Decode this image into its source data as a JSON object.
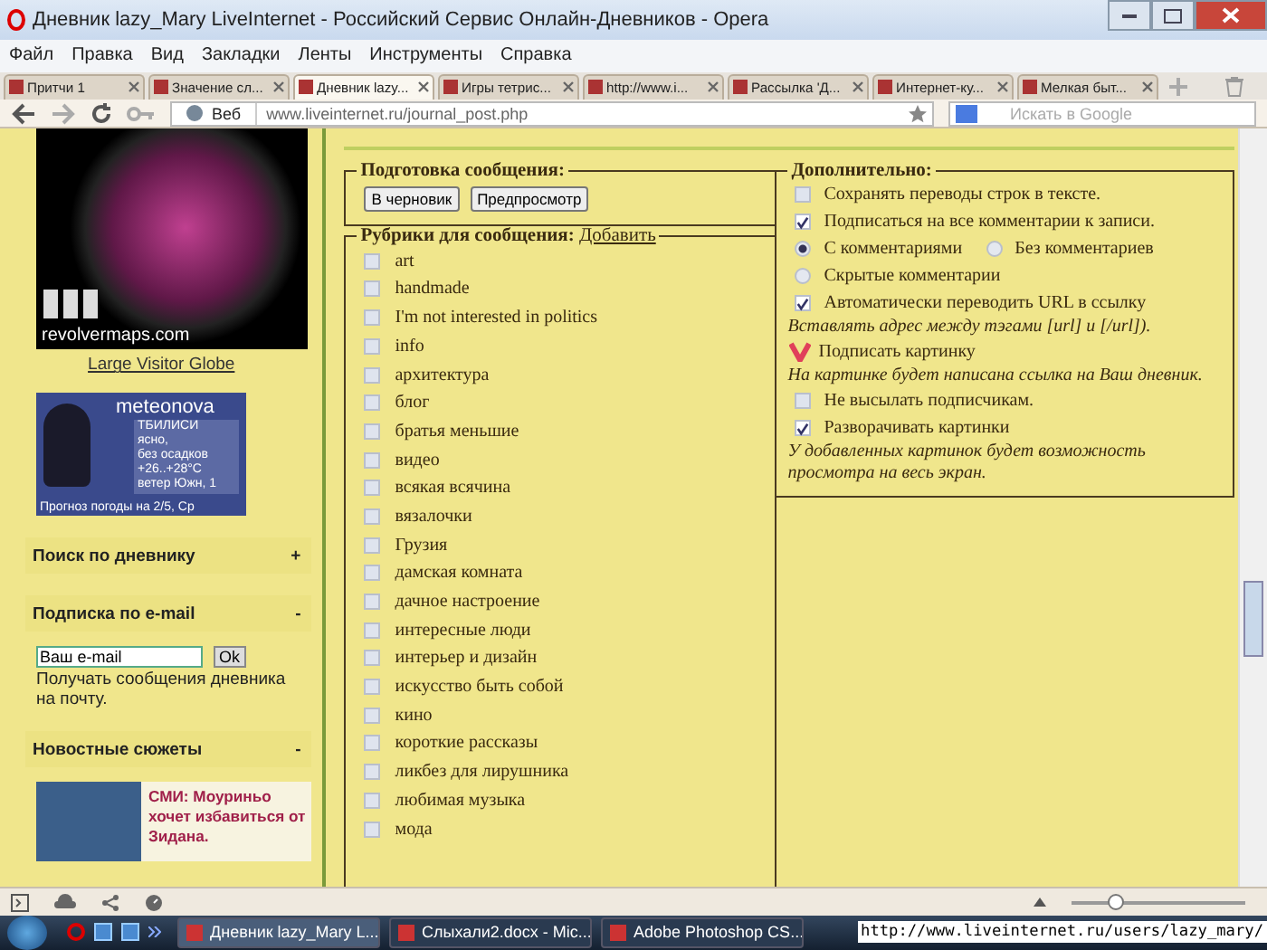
{
  "window": {
    "title": "Дневник lazy_Mary LiveInternet - Российский Сервис Онлайн-Дневников - Opera"
  },
  "menu": [
    "Файл",
    "Правка",
    "Вид",
    "Закладки",
    "Ленты",
    "Инструменты",
    "Справка"
  ],
  "tabs": [
    {
      "label": "Притчи 1",
      "selected": false
    },
    {
      "label": "Значение сл...",
      "selected": false
    },
    {
      "label": "Дневник lazy...",
      "selected": true
    },
    {
      "label": "Игры тетрис...",
      "selected": false
    },
    {
      "label": "http://www.i...",
      "selected": false
    },
    {
      "label": "Рассылка 'Д...",
      "selected": false
    },
    {
      "label": "Интернет-ку...",
      "selected": false
    },
    {
      "label": "Мелкая быт...",
      "selected": false
    }
  ],
  "address": {
    "scope": "Веб",
    "url": "www.liveinternet.ru/journal_post.php",
    "search_placeholder": "Искать в Google"
  },
  "sidebar": {
    "globe": {
      "caption": "revolvermaps.com",
      "link": "Large Visitor Globe"
    },
    "weather": {
      "brand": "meteonova",
      "lines": [
        "ТБИЛИСИ",
        "ясно,",
        "без осадков",
        "+26..+28°C",
        "ветер Южн, 1"
      ],
      "footer": "Прогноз погоды на 2/5, Ср"
    },
    "blocks": [
      {
        "title": "Поиск по дневнику",
        "toggle": "+"
      },
      {
        "title": "Подписка по e-mail",
        "toggle": "-"
      }
    ],
    "subscribe": {
      "value": "Ваш e-mail",
      "button": "Ok",
      "note": "Получать сообщения дневника на почту."
    },
    "news": {
      "title": "Новостные сюжеты",
      "toggle": "-",
      "headline": "СМИ: Моуриньо хочет избавиться от Зидана."
    }
  },
  "prepare": {
    "legend": "Подготовка сообщения:",
    "buttons": [
      "В черновик",
      "Предпросмотр"
    ]
  },
  "rubrics": {
    "legend": "Рубрики для сообщения:",
    "add_link": "Добавить",
    "items": [
      {
        "label": "art",
        "checked": false
      },
      {
        "label": "handmade",
        "checked": false
      },
      {
        "label": "I'm not interested in politics",
        "checked": false
      },
      {
        "label": "info",
        "checked": false
      },
      {
        "label": "архитектура",
        "checked": false
      },
      {
        "label": "блог",
        "checked": false
      },
      {
        "label": "братья меньшие",
        "checked": false
      },
      {
        "label": "видео",
        "checked": false
      },
      {
        "label": "всякая всячина",
        "checked": false
      },
      {
        "label": "вязалочки",
        "checked": false
      },
      {
        "label": "Грузия",
        "checked": false
      },
      {
        "label": "дамская комната",
        "checked": false
      },
      {
        "label": "дачное настроение",
        "checked": false
      },
      {
        "label": "интересные люди",
        "checked": false
      },
      {
        "label": "интерьер и дизайн",
        "checked": false
      },
      {
        "label": "искусство быть собой",
        "checked": false
      },
      {
        "label": "кино",
        "checked": false
      },
      {
        "label": "короткие рассказы",
        "checked": false
      },
      {
        "label": "ликбез для лирушника",
        "checked": false
      },
      {
        "label": "любимая музыка",
        "checked": false
      },
      {
        "label": "мода",
        "checked": false
      }
    ]
  },
  "advanced": {
    "legend": "Дополнительно:",
    "options": [
      {
        "kind": "checkbox",
        "label": "Сохранять переводы строк в тексте.",
        "checked": false
      },
      {
        "kind": "checkbox",
        "label": "Подписаться на все комментарии к записи.",
        "checked": true
      },
      {
        "kind": "radios",
        "choices": [
          {
            "label": "С комментариями",
            "selected": true
          },
          {
            "label": "Без комментариев",
            "selected": false
          }
        ]
      },
      {
        "kind": "radios",
        "choices": [
          {
            "label": "Скрытые комментарии",
            "selected": false
          }
        ]
      },
      {
        "kind": "checkbox",
        "label": "Автоматически переводить URL в ссылку",
        "checked": true
      },
      {
        "kind": "hint",
        "label": "Вставлять адрес между тэгами [url] и [/url])."
      },
      {
        "kind": "tick",
        "label": "Подписать картинку",
        "checked": true
      },
      {
        "kind": "hint",
        "label": "На картинке будет написана ссылка на Ваш дневник."
      },
      {
        "kind": "checkbox",
        "label": "Не высылать подписчикам.",
        "checked": false
      },
      {
        "kind": "checkbox",
        "label": "Разворачивать картинки",
        "checked": true
      },
      {
        "kind": "hint",
        "label": "У добавленных картинок будет возможность просмотра на весь экран."
      }
    ]
  },
  "status_bar": {
    "zoom": {
      "level": 0.25
    }
  },
  "taskbar": {
    "tasks": [
      {
        "label": "Дневник lazy_Mary L...",
        "selected": true
      },
      {
        "label": "Слыхали2.docx - Mic...",
        "selected": false
      },
      {
        "label": "Adobe Photoshop CS...",
        "selected": false
      }
    ],
    "status_url": "http://www.liveinternet.ru/users/lazy_mary/"
  }
}
